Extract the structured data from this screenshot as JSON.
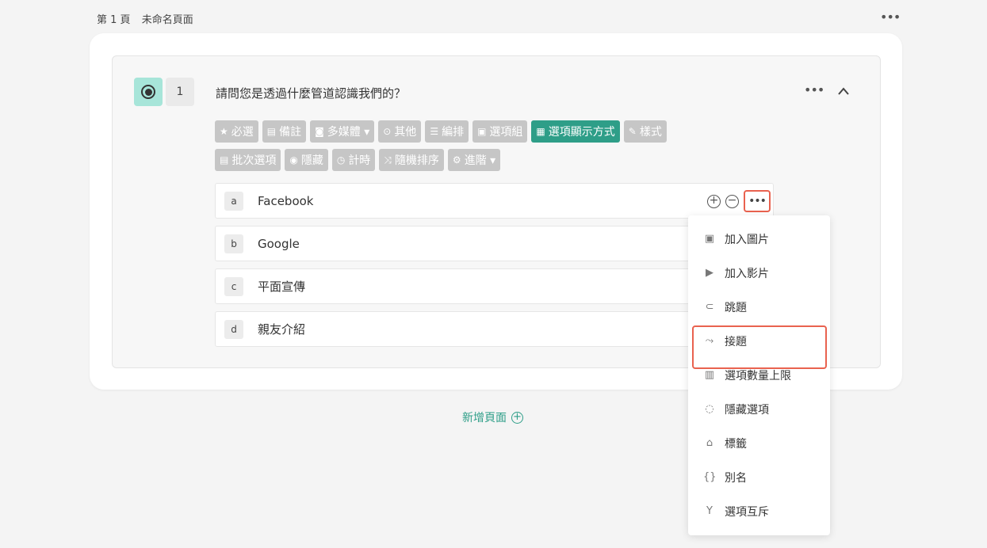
{
  "page": {
    "label": "第 1 頁",
    "name": "未命名頁面",
    "menu_icon": "more-horizontal-icon"
  },
  "question": {
    "number": "1",
    "title": "請問您是透過什麼管道認識我們的？",
    "type_icon": "radio-icon"
  },
  "toolbar": [
    {
      "icon": "★",
      "label": "必選"
    },
    {
      "icon": "▤",
      "label": "備註"
    },
    {
      "icon": "◙",
      "label": "多媒體 ▾"
    },
    {
      "icon": "⊙",
      "label": "其他"
    },
    {
      "icon": "☰",
      "label": "編排"
    },
    {
      "icon": "▣",
      "label": "選項組"
    },
    {
      "icon": "▦",
      "label": "選項顯示方式",
      "active": true
    },
    {
      "icon": "✎",
      "label": "樣式"
    },
    {
      "icon": "▤",
      "label": "批次選項"
    },
    {
      "icon": "◉",
      "label": "隱藏"
    },
    {
      "icon": "◷",
      "label": "計時"
    },
    {
      "icon": "⤨",
      "label": "隨機排序"
    },
    {
      "icon": "⚙",
      "label": "進階 ▾"
    }
  ],
  "options": [
    {
      "letter": "a",
      "text": "Facebook"
    },
    {
      "letter": "b",
      "text": "Google"
    },
    {
      "letter": "c",
      "text": "平面宣傳"
    },
    {
      "letter": "d",
      "text": "親友介紹"
    }
  ],
  "add_page": {
    "label": "新增頁面"
  },
  "dropdown": [
    {
      "icon": "▣",
      "icon_name": "image-icon",
      "label": "加入圖片"
    },
    {
      "icon": "▶",
      "icon_name": "video-icon",
      "label": "加入影片"
    },
    {
      "icon": "⊂",
      "icon_name": "jump-icon",
      "label": "跳題"
    },
    {
      "icon": "⤳",
      "icon_name": "connect-icon",
      "label": "接題",
      "highlight": true
    },
    {
      "icon": "▥",
      "icon_name": "limit-icon",
      "label": "選項數量上限"
    },
    {
      "icon": "◌",
      "icon_name": "eye-off-icon",
      "label": "隱藏選項"
    },
    {
      "icon": "⌂",
      "icon_name": "tag-icon",
      "label": "標籤"
    },
    {
      "icon": "{}",
      "icon_name": "braces-icon",
      "label": "別名"
    },
    {
      "icon": "Y",
      "icon_name": "fork-icon",
      "label": "選項互斥"
    }
  ],
  "colors": {
    "accent": "#2e9e88",
    "highlight": "#e9624f",
    "type_bg": "#a7e5d9",
    "toolbar_bg": "#c6c6c6"
  }
}
